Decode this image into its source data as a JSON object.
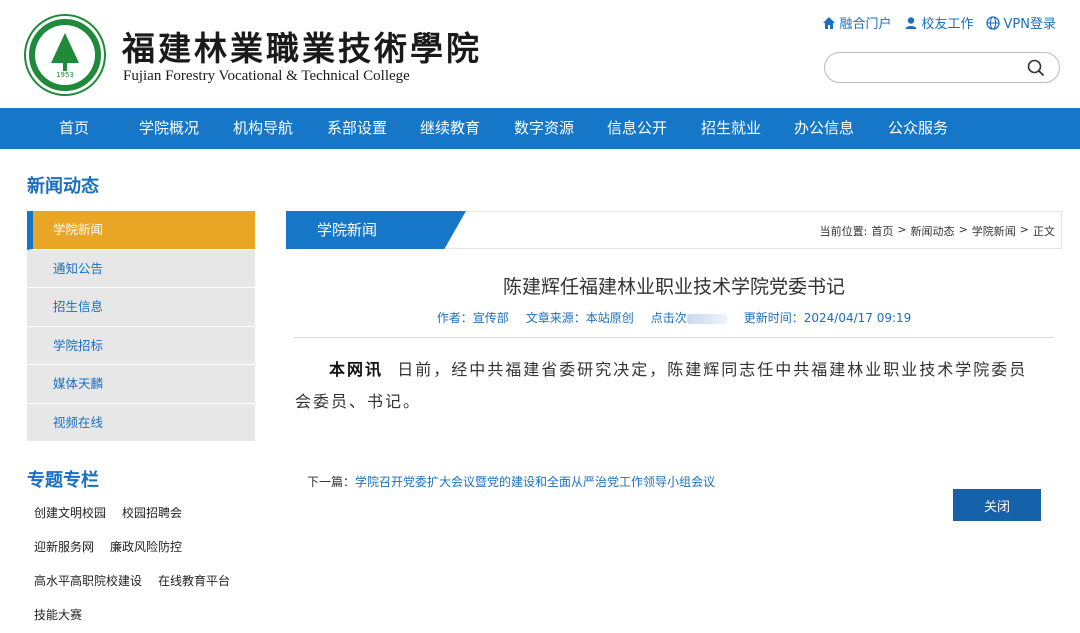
{
  "header": {
    "logo_year": "1953",
    "college_cn": "福建林業職業技術學院",
    "college_en": "Fujian Forestry Vocational & Technical College",
    "toplinks": [
      {
        "label": "融合门户",
        "icon": "home-icon"
      },
      {
        "label": "校友工作",
        "icon": "person-icon"
      },
      {
        "label": "VPN登录",
        "icon": "globe-icon"
      }
    ],
    "search_placeholder": ""
  },
  "nav": {
    "items": [
      "首页",
      "学院概况",
      "机构导航",
      "系部设置",
      "继续教育",
      "数字资源",
      "信息公开",
      "招生就业",
      "办公信息",
      "公众服务"
    ]
  },
  "sidebar": {
    "title": "新闻动态",
    "items": [
      "学院新闻",
      "通知公告",
      "招生信息",
      "学院招标",
      "媒体天麟",
      "视频在线"
    ],
    "active_index": 0
  },
  "topics": {
    "title": "专题专栏",
    "rows": [
      [
        "创建文明校园",
        "校园招聘会"
      ],
      [
        "迎新服务网",
        "廉政风险防控"
      ],
      [
        "高水平高职院校建设",
        "在线教育平台"
      ],
      [
        "技能大赛"
      ]
    ]
  },
  "breadcrumb": {
    "tab": "学院新闻",
    "prefix": "当前位置:",
    "path": [
      "首页",
      "新闻动态",
      "学院新闻",
      "正文"
    ],
    "separator": ">"
  },
  "article": {
    "title": "陈建辉任福建林业职业技术学院党委书记",
    "author": "作者：宣传部",
    "source": "文章来源：本站原创",
    "clicks": "点击次",
    "updated": "更新时间：2024/04/17 09:19",
    "lead": "本网讯",
    "body": "日前，经中共福建省委研究决定，陈建辉同志任中共福建林业职业技术学院委员会委员、书记。"
  },
  "next": {
    "label": "下一篇：",
    "title": "学院召开党委扩大会议暨党的建设和全面从严治党工作领导小组会议"
  },
  "close_label": "关闭",
  "colors": {
    "nav_blue": "#1677c8",
    "active_orange": "#e9a524",
    "link_blue": "#1a6fc1",
    "logo_green": "#1f8a3a"
  }
}
